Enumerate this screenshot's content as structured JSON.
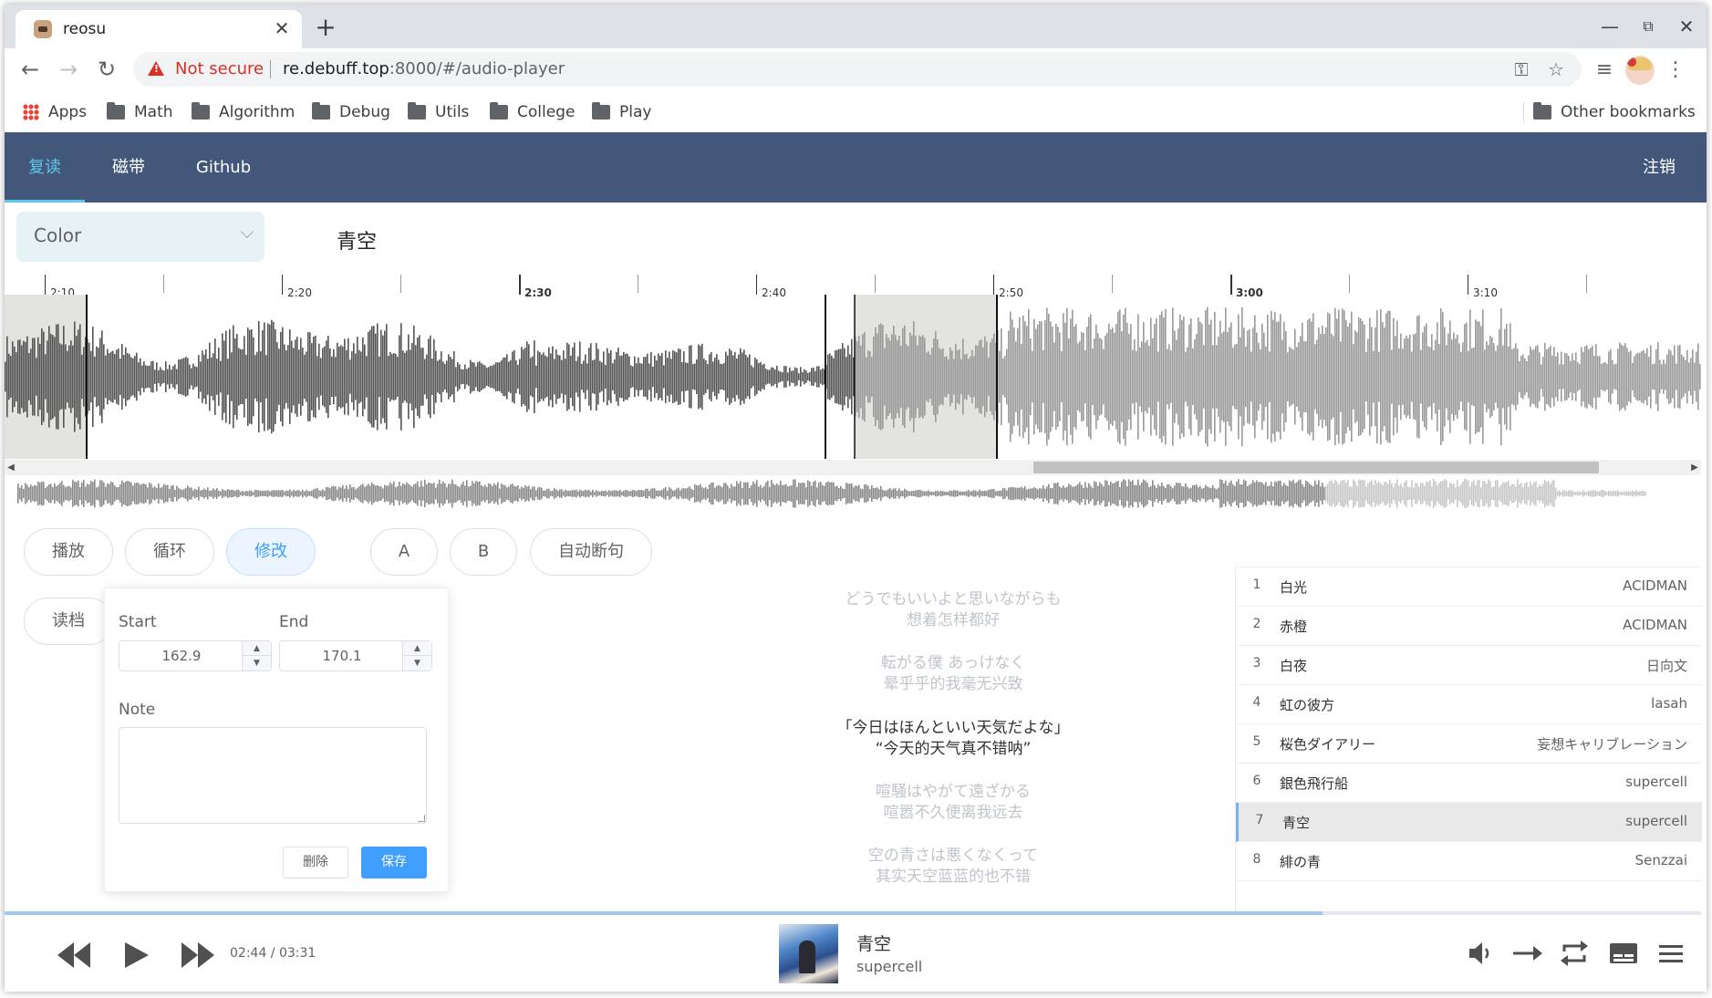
{
  "browser": {
    "tab_title": "reosu",
    "tab_close": "✕",
    "new_tab": "+",
    "minimize": "—",
    "restore": "⧉",
    "close": "✕",
    "not_secure": "Not secure",
    "url_host": "re.debuff.top",
    "url_rest": ":8000/#/audio-player",
    "bookmarks": [
      "Apps",
      "Math",
      "Algorithm",
      "Debug",
      "Utils",
      "College",
      "Play"
    ],
    "other_bookmarks": "Other bookmarks"
  },
  "nav": {
    "items": [
      "复读",
      "磁带",
      "Github"
    ],
    "active_index": 0,
    "logout": "注销",
    "active_color": "#5ec8e8",
    "bar_color": "#43577b"
  },
  "editor": {
    "color_select": "Color",
    "song_title": "青空"
  },
  "timeline": {
    "labels": [
      "2:10",
      "2:20",
      "2:30",
      "2:40",
      "2:50",
      "3:00",
      "3:10"
    ],
    "bold_labels": [
      "2:30",
      "3:00"
    ]
  },
  "controls": {
    "play": "播放",
    "loop": "循环",
    "edit": "修改",
    "a": "A",
    "b": "B",
    "auto_break": "自动断句",
    "load": "读档"
  },
  "popover": {
    "start_label": "Start",
    "end_label": "End",
    "start_value": "162.9",
    "end_value": "170.1",
    "note_label": "Note",
    "note_value": "",
    "delete": "删除",
    "save": "保存"
  },
  "lyrics": [
    {
      "jp": "どうでもいいよと思いながらも",
      "zh": "想着怎样都好",
      "current": false
    },
    {
      "jp": "転がる僕 あっけなく",
      "zh": "晕乎乎的我毫无兴致",
      "current": false
    },
    {
      "jp": "「今日はほんといい天気だよな」",
      "zh": "“今天的天气真不错呐”",
      "current": true
    },
    {
      "jp": "喧騒はやがて遠ざかる",
      "zh": "喧嚣不久便离我远去",
      "current": false
    },
    {
      "jp": "空の青さは悪くなくって",
      "zh": "其实天空蓝蓝的也不错",
      "current": false
    }
  ],
  "playlist": [
    {
      "num": "1",
      "title": "白光",
      "artist": "ACIDMAN"
    },
    {
      "num": "2",
      "title": "赤橙",
      "artist": "ACIDMAN"
    },
    {
      "num": "3",
      "title": "白夜",
      "artist": "日向文"
    },
    {
      "num": "4",
      "title": "虹の彼方",
      "artist": "lasah"
    },
    {
      "num": "5",
      "title": "桜色ダイアリー",
      "artist": "妄想キャリブレーション"
    },
    {
      "num": "6",
      "title": "銀色飛行船",
      "artist": "supercell"
    },
    {
      "num": "7",
      "title": "青空",
      "artist": "supercell",
      "current": true
    },
    {
      "num": "8",
      "title": "緋の青",
      "artist": "Senzzai"
    }
  ],
  "player": {
    "time": "02:44 / 03:31",
    "progress_fraction": 0.777,
    "title": "青空",
    "artist": "supercell"
  }
}
